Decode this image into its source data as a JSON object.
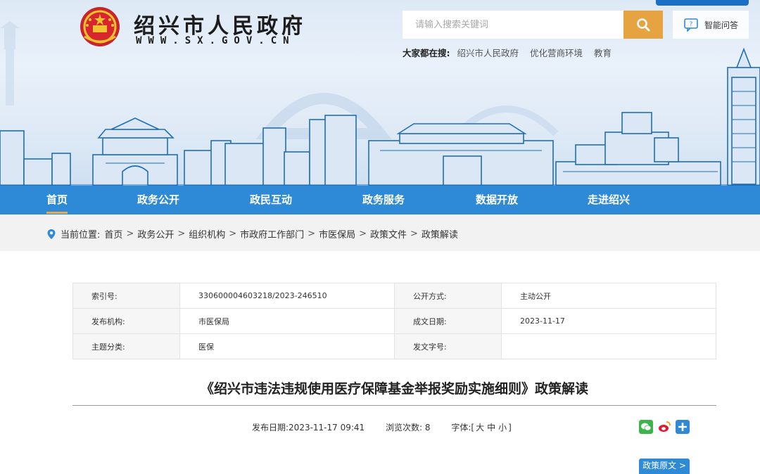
{
  "header": {
    "site_title": "绍兴市人民政府",
    "site_url": "WWW.SX.GOV.CN",
    "search_placeholder": "请输入搜索关键词",
    "ai_label": "智能问答",
    "hot_search_label": "大家都在搜:",
    "hot_search": [
      "绍兴市人民政府",
      "优化营商环境",
      "教育"
    ]
  },
  "nav": {
    "items": [
      "首页",
      "政务公开",
      "政民互动",
      "政务服务",
      "数据开放",
      "走进绍兴"
    ],
    "active_index": 0
  },
  "breadcrumb": {
    "label": "当前位置:",
    "items": [
      "首页",
      "政务公开",
      "组织机构",
      "市政府工作部门",
      "市医保局",
      "政策文件",
      "政策解读"
    ],
    "separator": ">"
  },
  "meta": {
    "index_label": "索引号:",
    "index_value": "330600004603218/2023-246510",
    "open_label": "公开方式:",
    "open_value": "主动公开",
    "publisher_label": "发布机构:",
    "publisher_value": "市医保局",
    "date_label": "成文日期:",
    "date_value": "2023-11-17",
    "topic_label": "主题分类:",
    "topic_value": "医保",
    "docno_label": "发文字号:",
    "docno_value": ""
  },
  "article": {
    "title": "《绍兴市违法违规使用医疗保障基金举报奖励实施细则》政策解读",
    "publish": "发布日期:2023-11-17 09:41",
    "views": "浏览次数: 8",
    "font_label": "字体:[",
    "font_large": "大",
    "font_medium": "中",
    "font_small": "小",
    "font_end": "]",
    "original_button": "政策原文 >"
  },
  "colors": {
    "nav_blue": "#2e8ad6",
    "accent_orange": "#e6a341",
    "nav_active_underline": "#f0a640"
  }
}
